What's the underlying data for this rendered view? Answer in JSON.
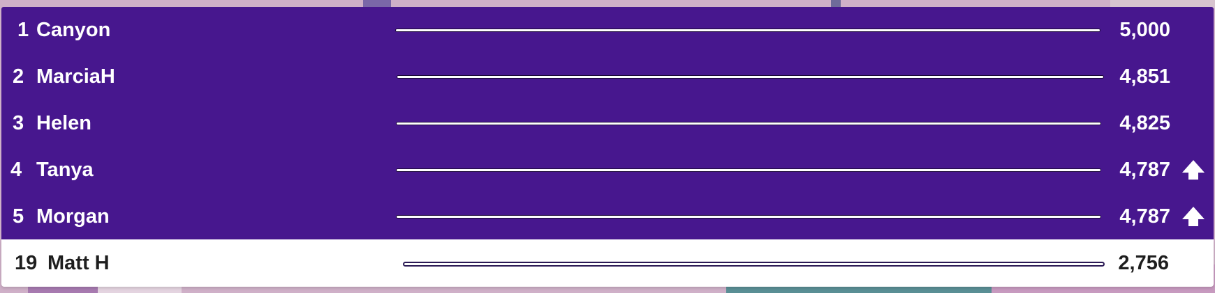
{
  "leaderboard": {
    "rows": [
      {
        "rank": "1",
        "name": "Canyon",
        "score": "5,000",
        "progress": 1.0,
        "trend": null
      },
      {
        "rank": "2",
        "name": "MarciaH",
        "score": "4,851",
        "progress": 1.0,
        "trend": null
      },
      {
        "rank": "3",
        "name": "Helen",
        "score": "4,825",
        "progress": 1.0,
        "trend": null
      },
      {
        "rank": "4",
        "name": "Tanya",
        "score": "4,787",
        "progress": 1.0,
        "trend": "up-arrow-icon"
      },
      {
        "rank": "5",
        "name": "Morgan",
        "score": "4,787",
        "progress": 1.0,
        "trend": "up-arrow-icon"
      }
    ],
    "current_user": {
      "rank": "19",
      "name": "Matt H",
      "score": "2,756",
      "progress": 1.0
    }
  },
  "colors": {
    "panel": "#47178e",
    "text_light": "#ffffff",
    "text_dark": "#1e1e1e",
    "current_user_bg": "#ffffff"
  }
}
